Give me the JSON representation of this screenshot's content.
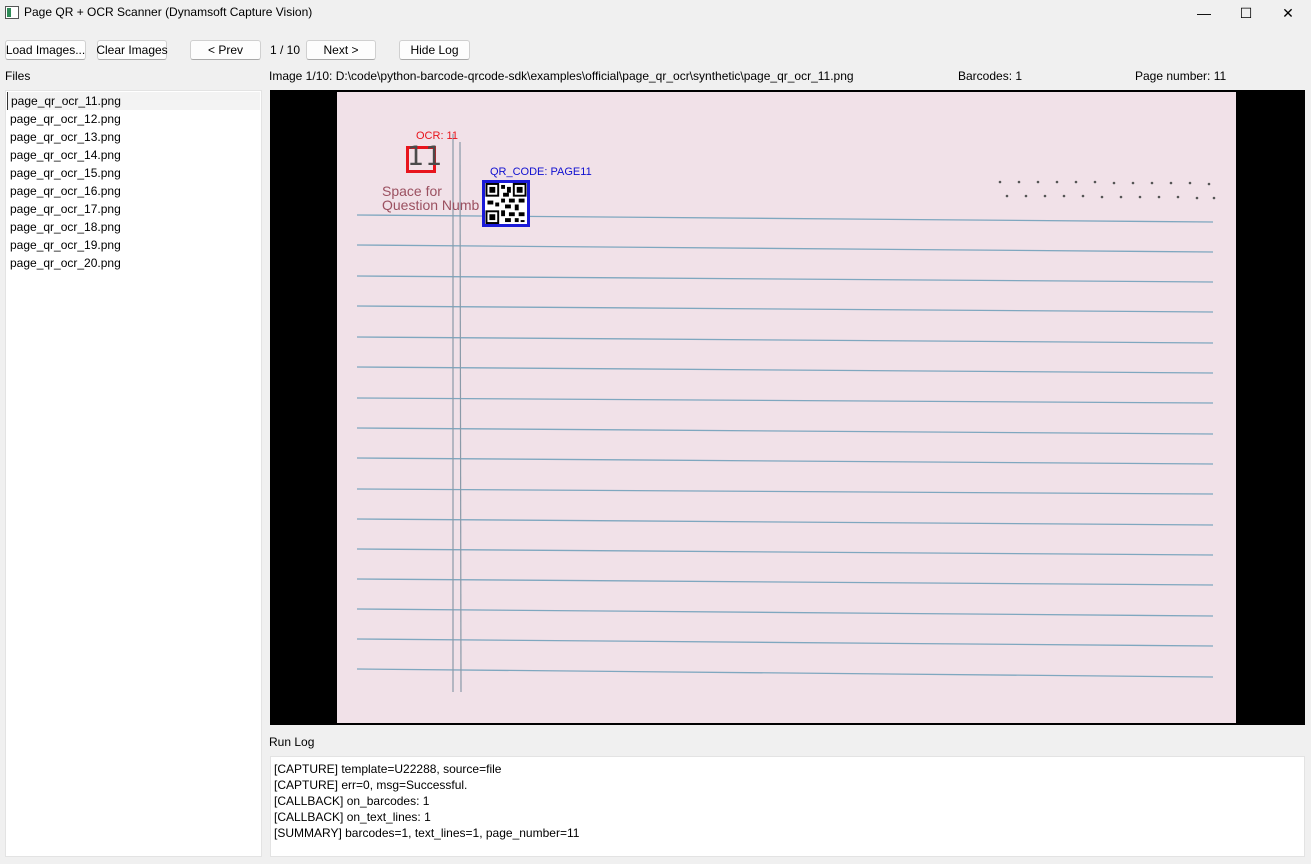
{
  "window": {
    "title": "Page QR + OCR Scanner (Dynamsoft Capture Vision)",
    "minimize": "—",
    "maximize": "☐",
    "close": "✕"
  },
  "toolbar": {
    "load_label": "Load Images...",
    "clear_label": "Clear Images",
    "prev_label": "< Prev",
    "page_counter": "1 / 10",
    "next_label": "Next >",
    "hide_log_label": "Hide Log"
  },
  "files_panel": {
    "title": "Files",
    "items": [
      "page_qr_ocr_11.png",
      "page_qr_ocr_12.png",
      "page_qr_ocr_13.png",
      "page_qr_ocr_14.png",
      "page_qr_ocr_15.png",
      "page_qr_ocr_16.png",
      "page_qr_ocr_17.png",
      "page_qr_ocr_18.png",
      "page_qr_ocr_19.png",
      "page_qr_ocr_20.png"
    ],
    "selected_index": 0
  },
  "status": {
    "image_path": "Image 1/10: D:\\code\\python-barcode-qrcode-sdk\\examples\\official\\page_qr_ocr\\synthetic\\page_qr_ocr_11.png",
    "barcodes": "Barcodes: 1",
    "page_number": "Page number: 11"
  },
  "image": {
    "ocr_label": "OCR: 11",
    "ocr_text": "11",
    "qr_label": "QR_CODE: PAGE11",
    "space_line1": "Space for",
    "space_line2": "Question Numb",
    "ocr_color": "#e8141c",
    "qr_color": "#1a1ad8"
  },
  "log": {
    "title": "Run Log",
    "lines": [
      "[CAPTURE] template=U22288, source=file",
      "[CAPTURE] err=0, msg=Successful.",
      "[CALLBACK] on_barcodes: 1",
      "[CALLBACK] on_text_lines: 1",
      "[SUMMARY] barcodes=1, text_lines=1, page_number=11"
    ]
  }
}
